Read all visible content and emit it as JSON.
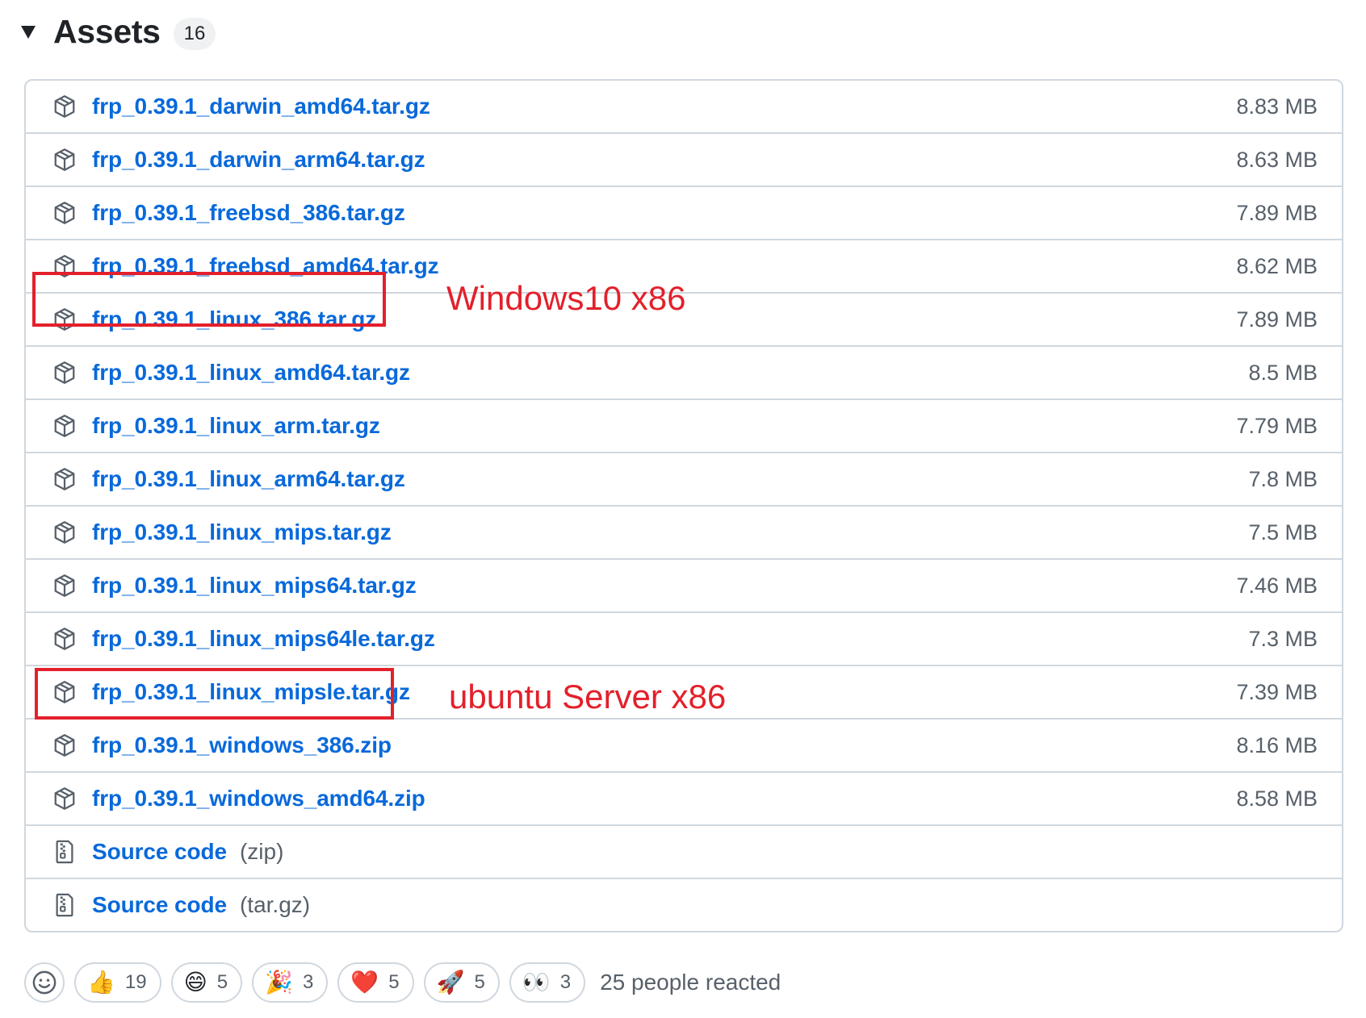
{
  "header": {
    "title": "Assets",
    "count": "16"
  },
  "assets": [
    {
      "name": "frp_0.39.1_darwin_amd64.tar.gz",
      "size": "8.83 MB",
      "icon": "package-icon"
    },
    {
      "name": "frp_0.39.1_darwin_arm64.tar.gz",
      "size": "8.63 MB",
      "icon": "package-icon"
    },
    {
      "name": "frp_0.39.1_freebsd_386.tar.gz",
      "size": "7.89 MB",
      "icon": "package-icon"
    },
    {
      "name": "frp_0.39.1_freebsd_amd64.tar.gz",
      "size": "8.62 MB",
      "icon": "package-icon"
    },
    {
      "name": "frp_0.39.1_linux_386.tar.gz",
      "size": "7.89 MB",
      "icon": "package-icon"
    },
    {
      "name": "frp_0.39.1_linux_amd64.tar.gz",
      "size": "8.5 MB",
      "icon": "package-icon"
    },
    {
      "name": "frp_0.39.1_linux_arm.tar.gz",
      "size": "7.79 MB",
      "icon": "package-icon"
    },
    {
      "name": "frp_0.39.1_linux_arm64.tar.gz",
      "size": "7.8 MB",
      "icon": "package-icon"
    },
    {
      "name": "frp_0.39.1_linux_mips.tar.gz",
      "size": "7.5 MB",
      "icon": "package-icon"
    },
    {
      "name": "frp_0.39.1_linux_mips64.tar.gz",
      "size": "7.46 MB",
      "icon": "package-icon"
    },
    {
      "name": "frp_0.39.1_linux_mips64le.tar.gz",
      "size": "7.3 MB",
      "icon": "package-icon"
    },
    {
      "name": "frp_0.39.1_linux_mipsle.tar.gz",
      "size": "7.39 MB",
      "icon": "package-icon"
    },
    {
      "name": "frp_0.39.1_windows_386.zip",
      "size": "8.16 MB",
      "icon": "package-icon"
    },
    {
      "name": "frp_0.39.1_windows_amd64.zip",
      "size": "8.58 MB",
      "icon": "package-icon"
    }
  ],
  "source": [
    {
      "label": "Source code",
      "suffix": "(zip)",
      "icon": "file-zip-icon"
    },
    {
      "label": "Source code",
      "suffix": "(tar.gz)",
      "icon": "file-zip-icon"
    }
  ],
  "annotations": [
    {
      "text": "Windows10 x86",
      "color": "#e3202b"
    },
    {
      "text": "ubuntu Server x86",
      "color": "#e3202b"
    }
  ],
  "reactions": [
    {
      "emoji": "👍",
      "name": "thumbs-up",
      "count": "19"
    },
    {
      "emoji": "😄",
      "name": "laugh",
      "count": "5"
    },
    {
      "emoji": "🎉",
      "name": "hooray",
      "count": "3"
    },
    {
      "emoji": "❤️",
      "name": "heart",
      "count": "5"
    },
    {
      "emoji": "🚀",
      "name": "rocket",
      "count": "5"
    },
    {
      "emoji": "👀",
      "name": "eyes",
      "count": "3"
    }
  ],
  "reactions_summary": "25 people reacted",
  "colors": {
    "link": "#0969da",
    "border": "#d0d7de",
    "muted": "#57606a",
    "annotation": "#e3202b"
  }
}
